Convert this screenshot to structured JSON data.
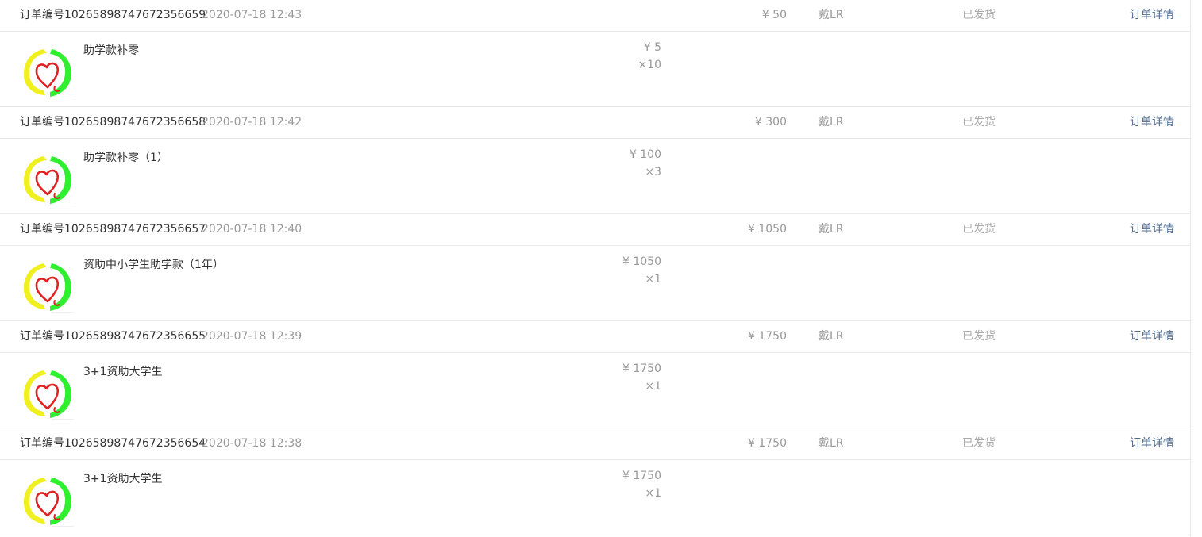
{
  "colors": {
    "link": "#506b8d",
    "muted": "#999999",
    "border": "#e8e8e8",
    "logo_yellow": "#f0f020",
    "logo_green": "#2ef02e",
    "logo_heart": "#e02020"
  },
  "icons": {
    "product_thumbnail": "donation-heart-logo"
  },
  "orders": [
    {
      "order_no": "订单编号10265898747672356659",
      "time": "2020-07-18 12:43",
      "total": "¥ 50",
      "buyer": "戴LR",
      "status": "已发货",
      "detail_link": "订单详情",
      "item": {
        "name": "助学款补零",
        "unit_price": "¥ 5",
        "quantity": "×10"
      }
    },
    {
      "order_no": "订单编号10265898747672356658",
      "time": "2020-07-18 12:42",
      "total": "¥ 300",
      "buyer": "戴LR",
      "status": "已发货",
      "detail_link": "订单详情",
      "item": {
        "name": "助学款补零（1）",
        "unit_price": "¥ 100",
        "quantity": "×3"
      }
    },
    {
      "order_no": "订单编号10265898747672356657",
      "time": "2020-07-18 12:40",
      "total": "¥ 1050",
      "buyer": "戴LR",
      "status": "已发货",
      "detail_link": "订单详情",
      "item": {
        "name": "资助中小学生助学款（1年）",
        "unit_price": "¥ 1050",
        "quantity": "×1"
      }
    },
    {
      "order_no": "订单编号10265898747672356655",
      "time": "2020-07-18 12:39",
      "total": "¥ 1750",
      "buyer": "戴LR",
      "status": "已发货",
      "detail_link": "订单详情",
      "item": {
        "name": "3+1资助大学生",
        "unit_price": "¥ 1750",
        "quantity": "×1"
      }
    },
    {
      "order_no": "订单编号10265898747672356654",
      "time": "2020-07-18 12:38",
      "total": "¥ 1750",
      "buyer": "戴LR",
      "status": "已发货",
      "detail_link": "订单详情",
      "item": {
        "name": "3+1资助大学生",
        "unit_price": "¥ 1750",
        "quantity": "×1"
      }
    }
  ]
}
